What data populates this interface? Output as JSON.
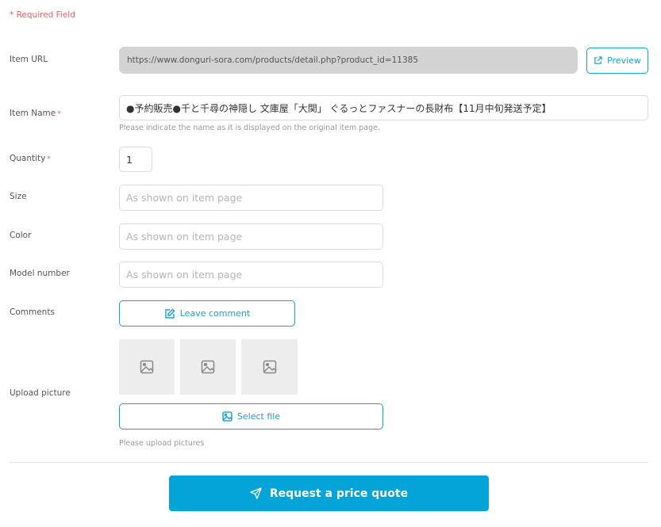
{
  "required_note": "* Required Field",
  "item_url": {
    "label": "Item URL",
    "value": "https://www.donguri-sora.com/products/detail.php?product_id=11385",
    "preview_label": "Preview"
  },
  "item_name": {
    "label": "Item Name",
    "required_mark": "*",
    "value": "●予約販売●千と千尋の神隠し 文庫屋「大関」 ぐるっとファスナーの長財布【11月中旬発送予定】",
    "hint": "Please indicate the name as it is displayed on the original item page."
  },
  "quantity": {
    "label": "Quantity",
    "required_mark": "*",
    "value": "1"
  },
  "size": {
    "label": "Size",
    "placeholder": "As shown on item page"
  },
  "color": {
    "label": "Color",
    "placeholder": "As shown on item page"
  },
  "model_number": {
    "label": "Model number",
    "placeholder": "As shown on item page"
  },
  "comments": {
    "label": "Comments",
    "button_label": "Leave comment"
  },
  "upload": {
    "label": "Upload picture",
    "thumbnails": [
      "image-placeholder",
      "image-placeholder",
      "image-placeholder"
    ],
    "select_label": "Select file",
    "hint": "Please upload pictures"
  },
  "submit": {
    "label": "Request a price quote"
  },
  "colors": {
    "accent": "#04a4d8",
    "required": "#e0646a",
    "url_bg": "#d3d3d3"
  }
}
